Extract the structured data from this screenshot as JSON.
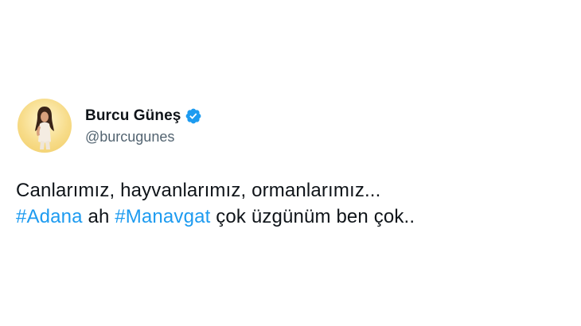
{
  "tweet": {
    "author": {
      "display_name": "Burcu Güneş",
      "handle": "@burcugunes",
      "verified_icon": "verified-badge-icon",
      "verified_color": "#1d9bf0"
    },
    "text": {
      "line1": "Canlarımız, hayvanlarımız, ormanlarımız...",
      "hashtag1": "#Adana",
      "word_ah": " ah ",
      "hashtag2": "#Manavgat",
      "line2_rest": " çok üzgünüm ben çok.."
    },
    "colors": {
      "text": "#0f1419",
      "secondary": "#536471",
      "link": "#1d9bf0",
      "background": "#ffffff"
    }
  }
}
